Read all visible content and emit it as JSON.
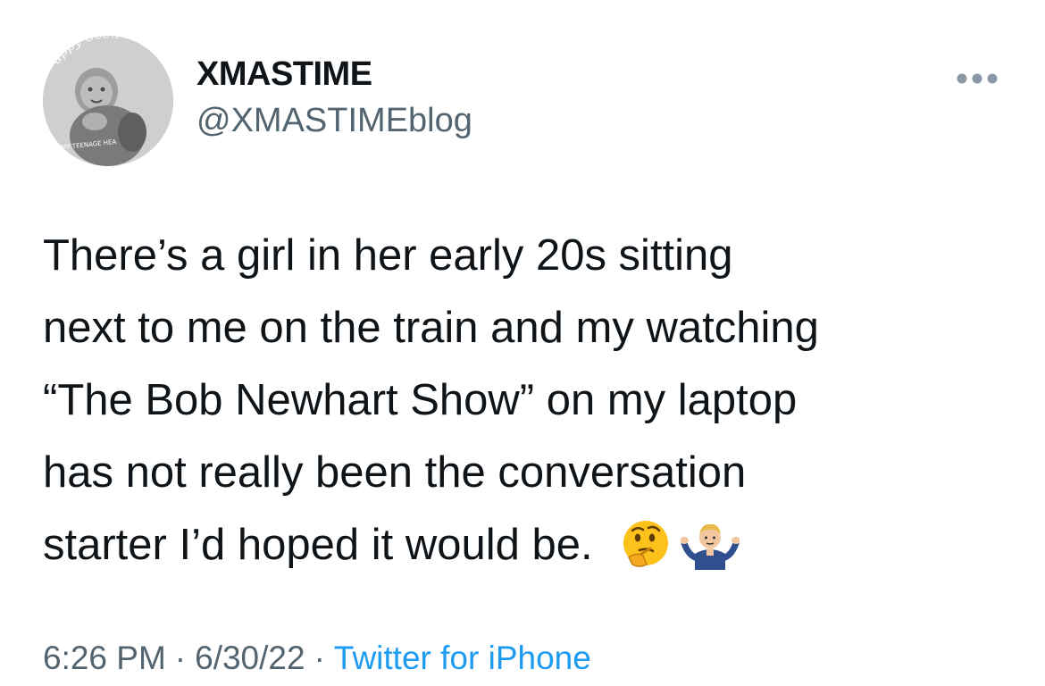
{
  "user": {
    "display_name": "XMASTIME",
    "handle": "@XMASTIMEblog",
    "avatar_caption_top": "appy Scen",
    "avatar_caption_bottom": "E MY TEENAGE HEA"
  },
  "tweet": {
    "lines": [
      "There’s a girl in her early 20s sitting",
      "next to me on the train and my watching",
      "“The Bob Newhart Show” on my laptop",
      "has not really been the conversation",
      "starter I’d hoped it would be."
    ],
    "emojis": [
      "thinking-face",
      "man-shrugging"
    ]
  },
  "meta": {
    "time": "6:26 PM",
    "separator": "·",
    "date": "6/30/22",
    "source": "Twitter for iPhone"
  },
  "colors": {
    "text": "#0f1419",
    "secondary": "#536471",
    "link": "#1d9bf0"
  }
}
